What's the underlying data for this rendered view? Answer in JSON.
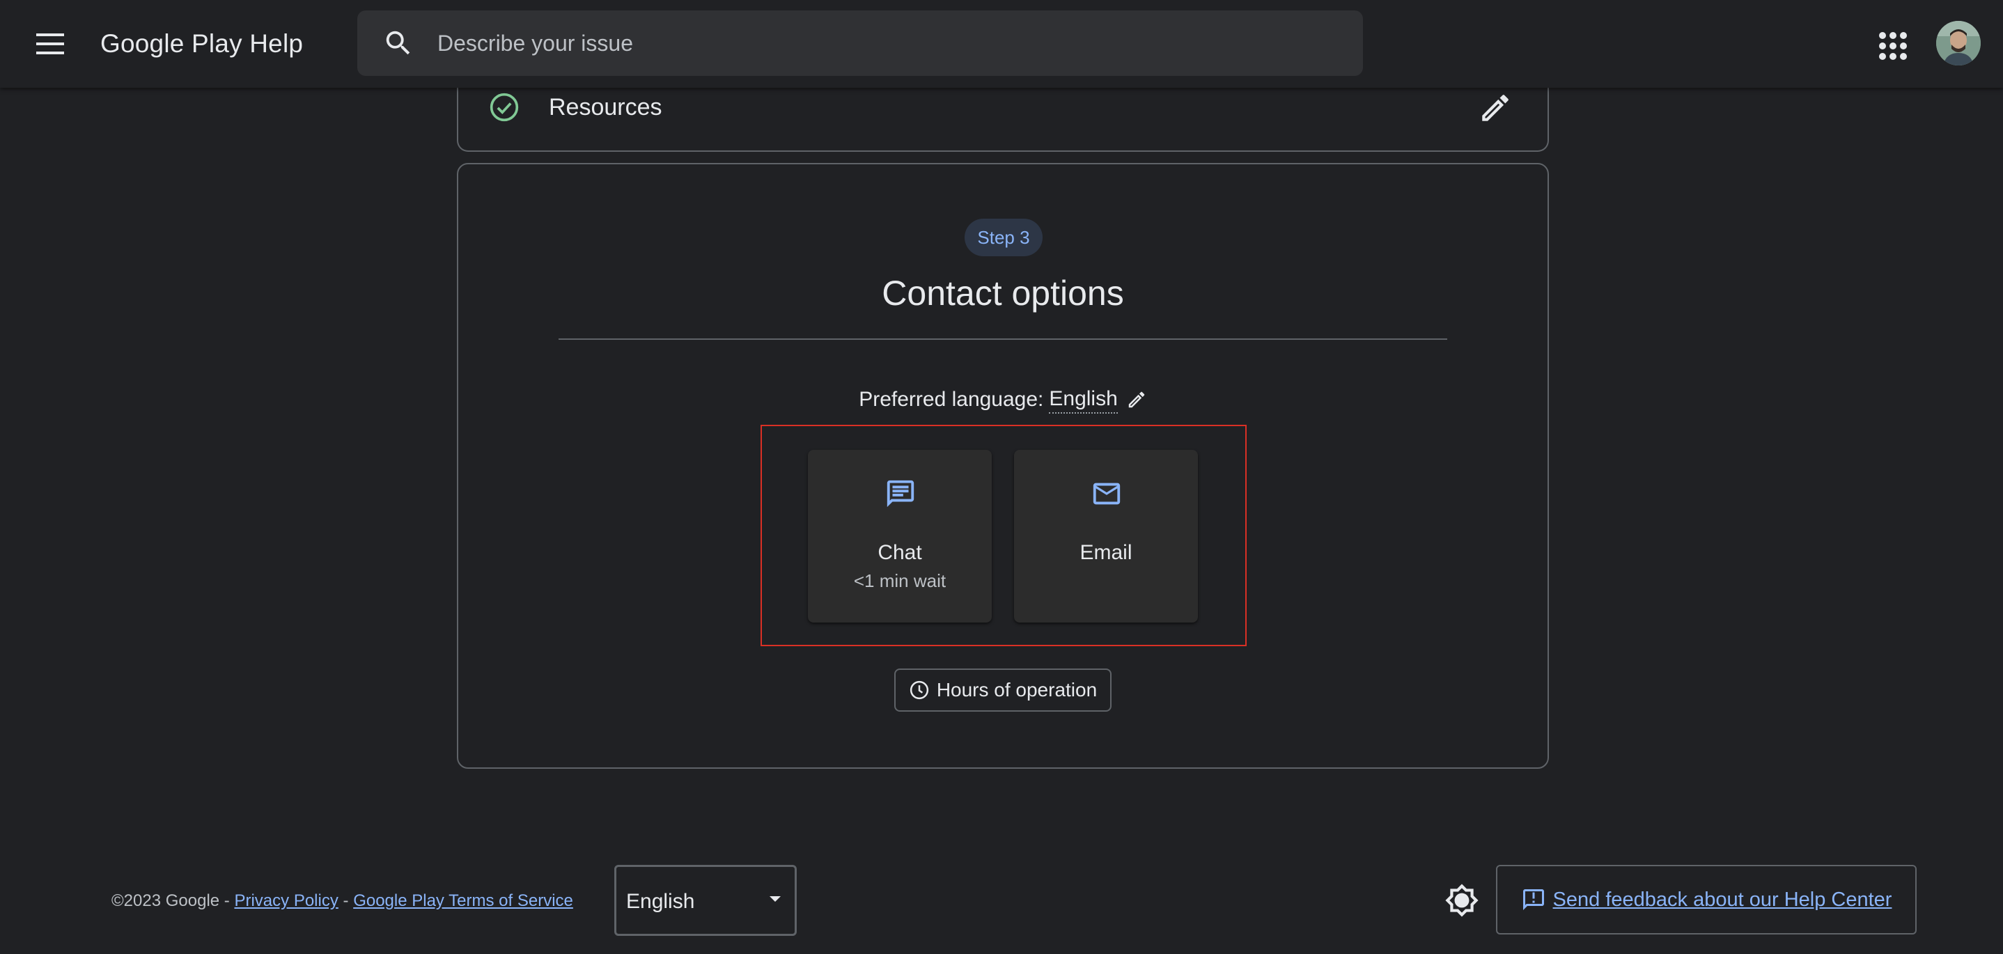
{
  "header": {
    "app_title": "Google Play Help",
    "search_placeholder": "Describe your issue"
  },
  "resources": {
    "label": "Resources"
  },
  "step": {
    "pill": "Step 3",
    "title": "Contact options",
    "preferred_language_label": "Preferred language:",
    "preferred_language_value": "English",
    "options": [
      {
        "label": "Chat",
        "sub": "<1 min wait"
      },
      {
        "label": "Email",
        "sub": ""
      }
    ],
    "hours_label": "Hours of operation"
  },
  "footer": {
    "copyright": "©2023 Google -",
    "privacy": "Privacy Policy",
    "separator": "-",
    "terms": "Google Play Terms of Service",
    "language": "English",
    "feedback": "Send feedback about our Help Center"
  },
  "colors": {
    "background": "#202124",
    "accent": "#8ab4f8",
    "success": "#81c995",
    "highlight": "#d93025"
  },
  "icons": [
    "menu-icon",
    "search-icon",
    "apps-icon",
    "avatar",
    "check-circle-icon",
    "pencil-icon",
    "chat-icon",
    "mail-icon",
    "clock-icon",
    "brightness-icon",
    "feedback-icon",
    "dropdown-arrow-icon"
  ]
}
